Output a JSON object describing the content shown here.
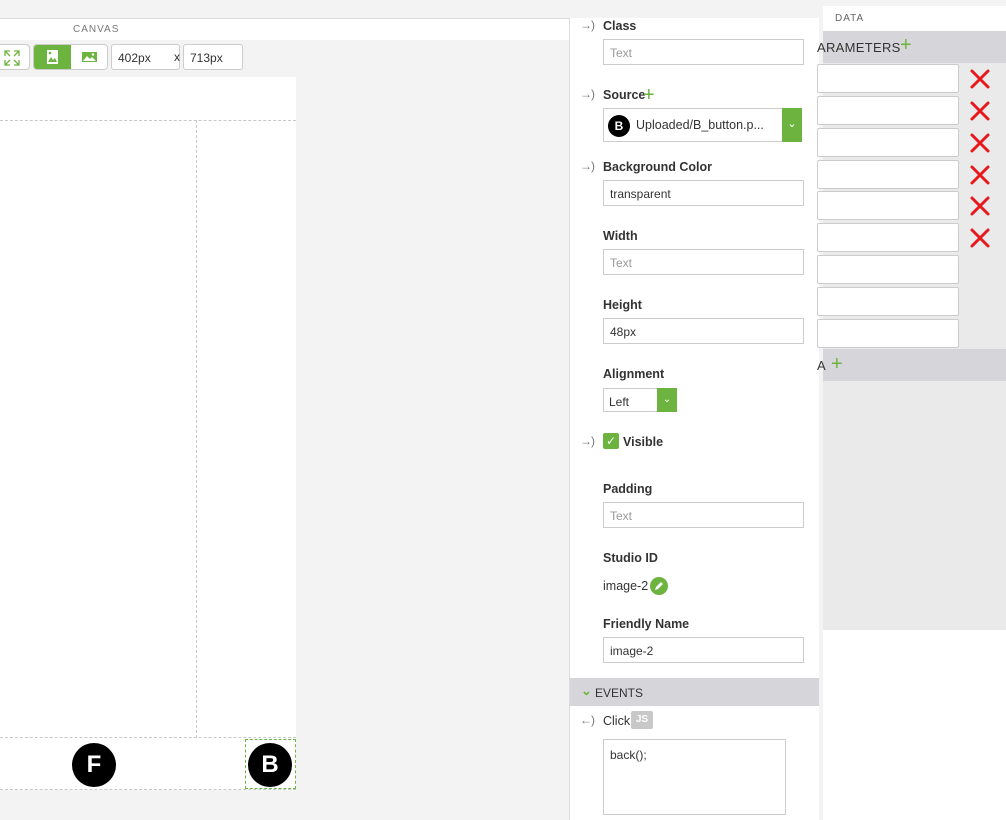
{
  "canvas": {
    "header": "CANVAS",
    "width_value": "402px",
    "size_separator": "x",
    "height_value": "713px",
    "buttons": {
      "f_label": "F",
      "b_label": "B"
    }
  },
  "properties": {
    "class": {
      "label": "Class",
      "placeholder": "Text"
    },
    "source": {
      "label": "Source",
      "badge": "B",
      "value": "Uploaded/B_button.p..."
    },
    "background_color": {
      "label": "Background Color",
      "value": "transparent"
    },
    "width": {
      "label": "Width",
      "placeholder": "Text"
    },
    "height": {
      "label": "Height",
      "value": "48px"
    },
    "alignment": {
      "label": "Alignment",
      "value": "Left"
    },
    "visible": {
      "label": "Visible",
      "checked": true
    },
    "padding": {
      "label": "Padding",
      "placeholder": "Text"
    },
    "studio_id": {
      "label": "Studio ID",
      "value": "image-2"
    },
    "friendly_name": {
      "label": "Friendly Name",
      "value": "image-2"
    },
    "arrow_in": "→)",
    "arrow_out": "←)"
  },
  "events": {
    "header": "EVENTS",
    "click": {
      "label": "Click",
      "badge": "JS",
      "code": "back();"
    }
  },
  "data_panel": {
    "header": "DATA",
    "parameters_label": "ARAMETERS",
    "second_section_label": "A"
  },
  "colors": {
    "accent": "#6db33f",
    "delete": "#e8191d",
    "section_bar": "#d6d6da"
  }
}
